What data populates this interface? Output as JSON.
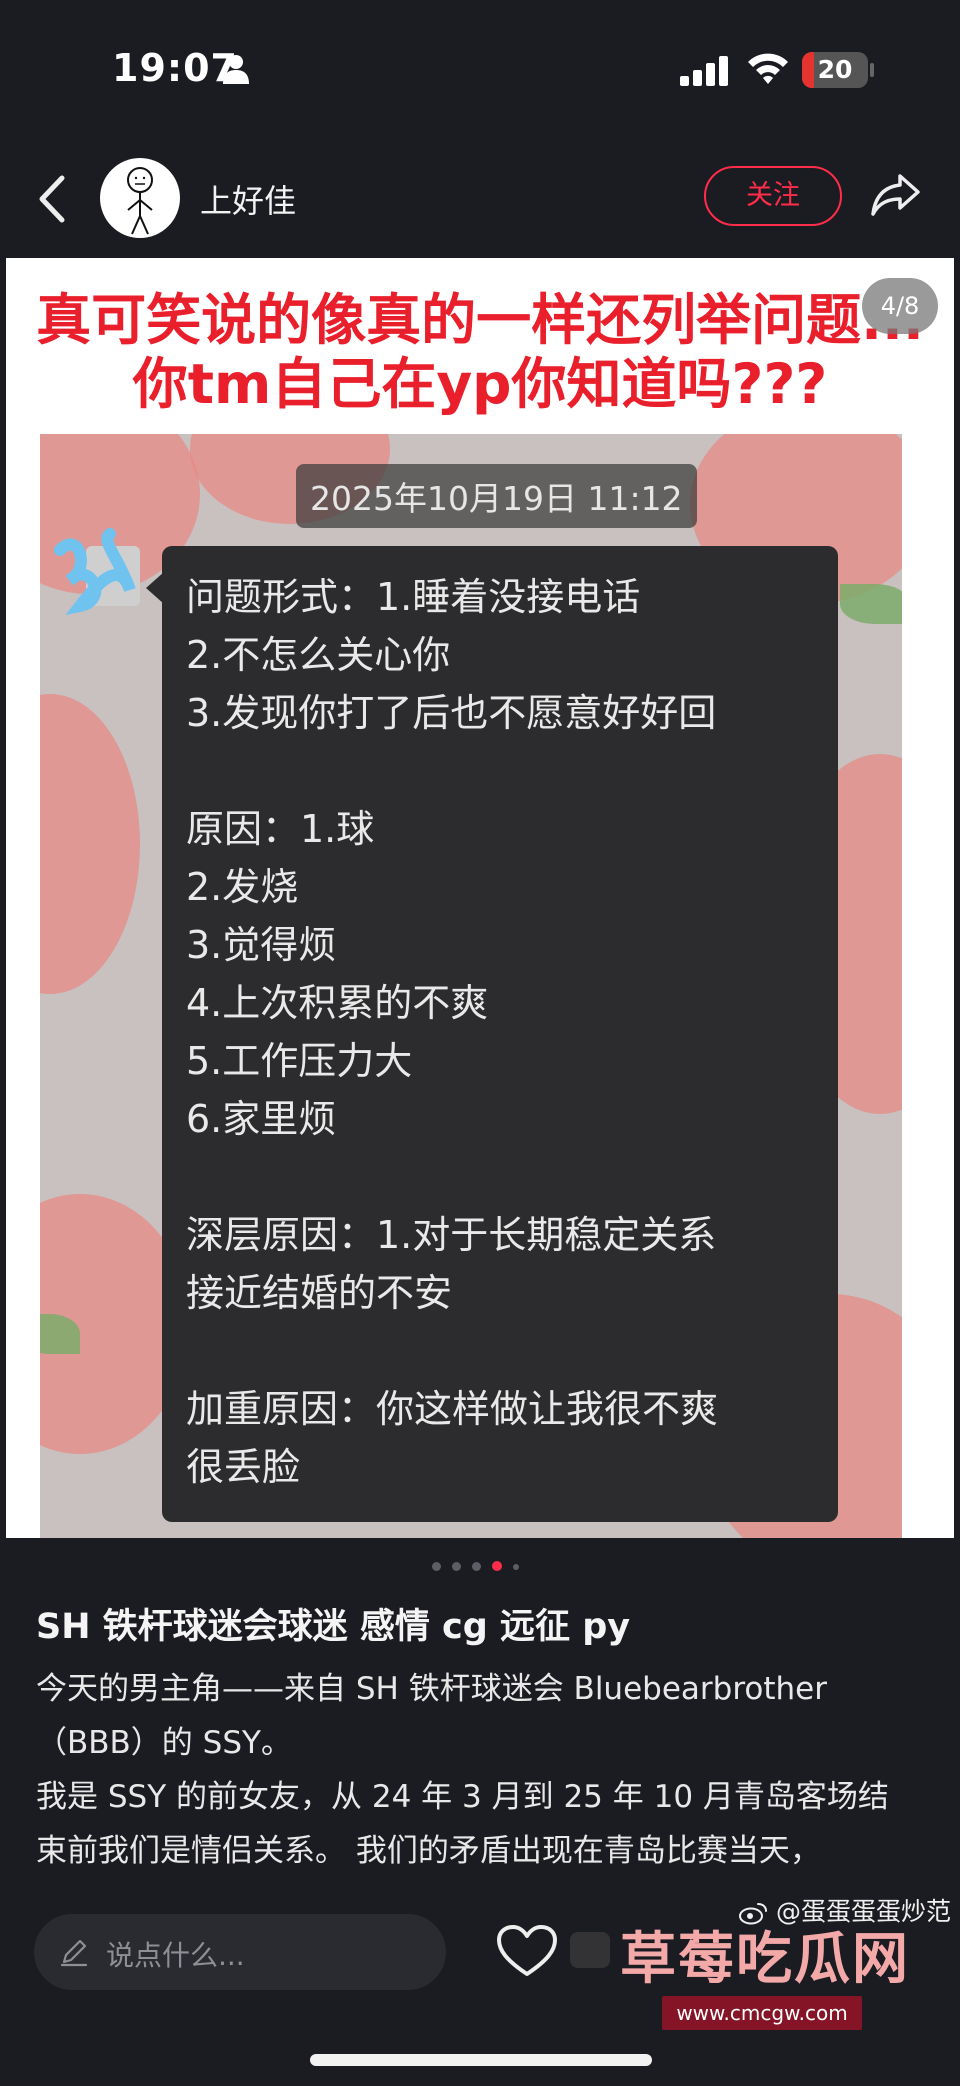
{
  "status_bar": {
    "time": "19:07",
    "battery_level": "20",
    "battery_percent": 0.2,
    "colors": {
      "battery_low": "#e5342f"
    }
  },
  "nav": {
    "username": "上好佳",
    "follow_label": "关注",
    "colors": {
      "follow": "#ff2d4a"
    }
  },
  "image": {
    "page_indicator": "4/8",
    "headline_line1": "真可笑说的像真的一样还列举问题...",
    "headline_line2": "你tm自己在yp你知道吗???",
    "chat": {
      "timestamp": "2025年10月19日 11:12",
      "lines": [
        "问题形式：1.睡着没接电话",
        "2.不怎么关心你",
        "3.发现你打了后也不愿意好好回",
        "",
        "原因：1.球",
        "2.发烧",
        "3.觉得烦",
        "4.上次积累的不爽",
        "5.工作压力大",
        "6.家里烦",
        "",
        "深层原因：1.对于长期稳定关系",
        "接近结婚的不安",
        "",
        "加重原因：你这样做让我很不爽",
        "很丢脸"
      ]
    }
  },
  "carousel": {
    "current_page": 4,
    "total_pages": 8
  },
  "post": {
    "title": "SH 铁杆球迷会球迷  感情 cg 远征 py",
    "body_lines": [
      "今天的男主角——来自 SH 铁杆球迷会 Bluebearbrother",
      "（BBB）的 SSY。",
      "我是 SSY 的前女友，从 24 年 3 月到 25 年 10 月青岛客场结",
      "束前我们是情侣关系。 我们的矛盾出现在青岛比赛当天，"
    ]
  },
  "bottom_bar": {
    "comment_placeholder": "说点什么...",
    "watermark_text": "草莓吃瓜网",
    "watermark_url": "www.cmcgw.com",
    "weibo_credit": "@蛋蛋蛋蛋炒范"
  },
  "icons": [
    "person-icon",
    "signal-icon",
    "wifi-icon",
    "back-icon",
    "share-icon",
    "pencil-icon",
    "heart-icon",
    "weibo-icon"
  ]
}
